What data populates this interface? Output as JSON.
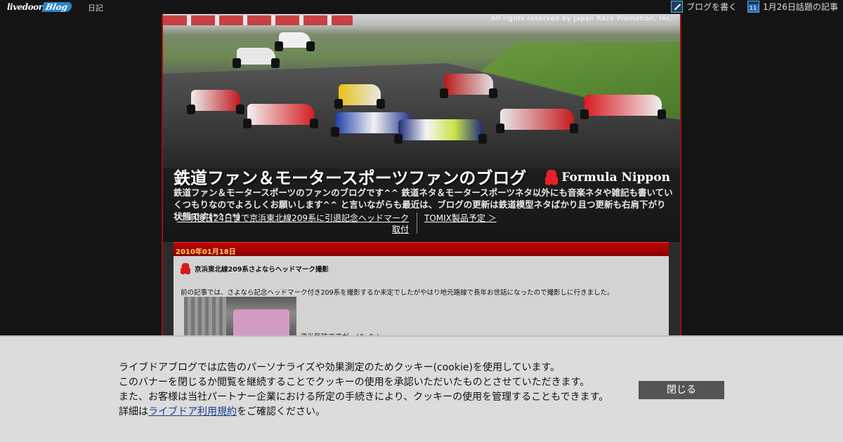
{
  "topbar": {
    "logo_livedoor": "livedoor",
    "logo_blog": "Blog",
    "nav_diary": "日記",
    "write_label": "ブログを書く",
    "topic_label": "1月26日話題の記事",
    "calendar_day": "11",
    "write_icon": "pen-icon",
    "topic_icon": "calendar-icon"
  },
  "header": {
    "copyright": "All rights reserved by Japan Race Promotion, Inc.",
    "series_logo": "Formula Nippon",
    "blog_title": "鉄道ファン＆モータースポーツファンのブログ",
    "blog_description": "鉄道ファン＆モータースポーツのファンのブログです^^ 鉄道ネタ＆モータースポーツネタ以外にも音楽ネタや雑記も書いていくつもりなのでよろしくお願いします^^ と言いながらも最近は、ブログの更新は鉄道模型ネタばかり且つ更新も右肩下がり状態です(*^^*)",
    "prev_entry": "＜ 明後日24日まで京浜東北線209系に引退記念ヘッドマーク取付",
    "next_entry": "TOMIX製品予定 ＞"
  },
  "entry": {
    "date": "2010年01月18日",
    "title": "京浜東北線209系さよならヘッドマーク撮影",
    "body": "前の記事では、さよなら記念ヘッドマーク付き209系を撮影するか未定でしたがやはり地元路線で長年お世話になったので撮影しに行きました。",
    "photo_caption": "逆光気味ですが…(^_^;)"
  },
  "cookie_banner": {
    "line1": "ライブドアブログでは広告のパーソナライズや効果測定のためクッキー(cookie)を使用しています。",
    "line2": "このバナーを閉じるか閲覧を継続することでクッキーの使用を承認いただいたものとさせていただきます。",
    "line3": "また、お客様は当社パートナー企業における所定の手続きにより、クッキーの使用を管理することもできます。",
    "line4_prefix": "詳細は",
    "line4_link": "ライブドア利用規約",
    "line4_suffix": "をご確認ください。",
    "close_label": "閉じる"
  },
  "colors": {
    "page_bg": "#141414",
    "accent_red": "#a50d0d",
    "date_text": "#ffd86a",
    "banner_bg": "#dcdcdc",
    "button_bg": "#555555"
  }
}
